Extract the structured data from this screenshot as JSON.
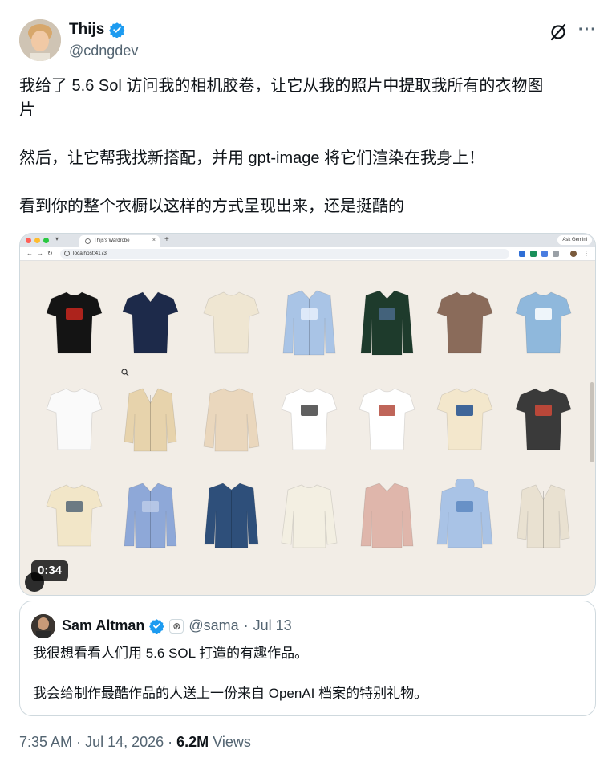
{
  "author": {
    "name": "Thijs",
    "handle": "@cdngdev"
  },
  "tweet": {
    "lines": [
      "我给了 5.6 Sol 访问我的相机胶卷，让它从我的照片中提取我所有的衣物图",
      "片",
      "然后，让它帮我找新搭配，并用 gpt-image 将它们渲染在我身上！",
      "看到你的整个衣橱以这样的方式呈现出来，还是挺酷的"
    ]
  },
  "browser": {
    "tab_title": "Thijs's Wardrobe",
    "url": "localhost:4173",
    "gemini_label": "Ask Gemini",
    "new_tab": "+",
    "tab_close": "×"
  },
  "video": {
    "duration": "0:34"
  },
  "garments": [
    {
      "type": "tshirt",
      "color": "#141414",
      "accent": "#c8261d"
    },
    {
      "type": "polo",
      "color": "#1d2a4a"
    },
    {
      "type": "tshirt",
      "color": "#efe6d2"
    },
    {
      "type": "shirt",
      "color": "#a9c4e6",
      "accent": "#e8f0fb"
    },
    {
      "type": "shirt",
      "color": "#1e3b2c",
      "accent": "#4a6a8a"
    },
    {
      "type": "tshirt",
      "color": "#8a6b5a"
    },
    {
      "type": "tshirt",
      "color": "#8fb8dc",
      "accent": "#ffffff"
    },
    {
      "type": "tshirt",
      "color": "#fafafa"
    },
    {
      "type": "cardigan",
      "color": "#e7d3ac"
    },
    {
      "type": "sweater",
      "color": "#ead7bd"
    },
    {
      "type": "tshirt",
      "color": "#ffffff",
      "accent": "#444444"
    },
    {
      "type": "tshirt",
      "color": "#ffffff",
      "accent": "#b44a3c"
    },
    {
      "type": "tshirt",
      "color": "#f3e7cc",
      "accent": "#1f4f8f"
    },
    {
      "type": "tshirt",
      "color": "#3a3a3a",
      "accent": "#d04a3a"
    },
    {
      "type": "tshirt",
      "color": "#f2e6c8",
      "accent": "#556677"
    },
    {
      "type": "shirt",
      "color": "#8ea8d8",
      "accent": "#bccbe9"
    },
    {
      "type": "jacket",
      "color": "#2e4f7a"
    },
    {
      "type": "sweater",
      "color": "#f3efe2"
    },
    {
      "type": "shirt",
      "color": "#dfb6ab"
    },
    {
      "type": "hoodie",
      "color": "#a9c3e6",
      "accent": "#5d88c1"
    },
    {
      "type": "cardigan",
      "color": "#e9e1d1"
    }
  ],
  "quoted_tweet": {
    "name": "Sam Altman",
    "handle": "@sama",
    "date": "Jul 13",
    "lines": [
      "我很想看看人们用 5.6 SOL 打造的有趣作品。",
      "我会给制作最酷作品的人送上一份来自 OpenAI 档案的特别礼物。"
    ]
  },
  "footer": {
    "time": "7:35 AM",
    "date": "Jul 14, 2026",
    "views_count": "6.2M",
    "views_label": "Views"
  },
  "colors": {
    "verified": "#1d9bf0",
    "secondary_text": "#536471",
    "border": "#cfd9de",
    "canvas": "#f2ede6"
  }
}
